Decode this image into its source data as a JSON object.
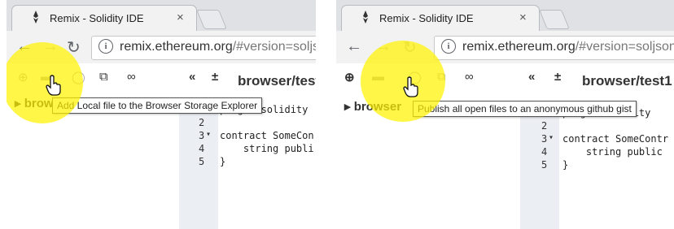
{
  "panels": [
    {
      "tab_title": "Remix - Solidity IDE",
      "tab_close": "×",
      "url_host": "remix.ethereum.org",
      "url_rest": "/#version=soljso",
      "file_name": "browser/test",
      "explorer_label": "browser",
      "tooltip": "Add Local file to the Browser Storage Explorer",
      "line_numbers": [
        "1",
        "2",
        "3",
        "4",
        "5"
      ],
      "code_lines": [
        "pragma solidity ",
        "",
        "contract SomeCon",
        "    string publi",
        "}"
      ]
    },
    {
      "tab_title": "Remix - Solidity IDE",
      "tab_close": "×",
      "url_host": "remix.ethereum.org",
      "url_rest": "/#version=soljson-",
      "file_name": "browser/test1",
      "explorer_label": "browser",
      "tooltip": "Publish all open files to an anonymous github gist",
      "line_numbers": [
        "1",
        "2",
        "3",
        "4",
        "5"
      ],
      "code_lines": [
        "pragma solidity ",
        "",
        "contract SomeContr",
        "    string public",
        "}"
      ]
    }
  ],
  "colors": {
    "highlight": "#fff200",
    "gutter": "#ebeef3"
  },
  "icons": [
    "remix-favicon",
    "back-arrow",
    "forward-arrow",
    "reload",
    "info",
    "new-file",
    "open-folder",
    "github",
    "copy",
    "link",
    "collapse",
    "plus",
    "hand-pointer"
  ]
}
